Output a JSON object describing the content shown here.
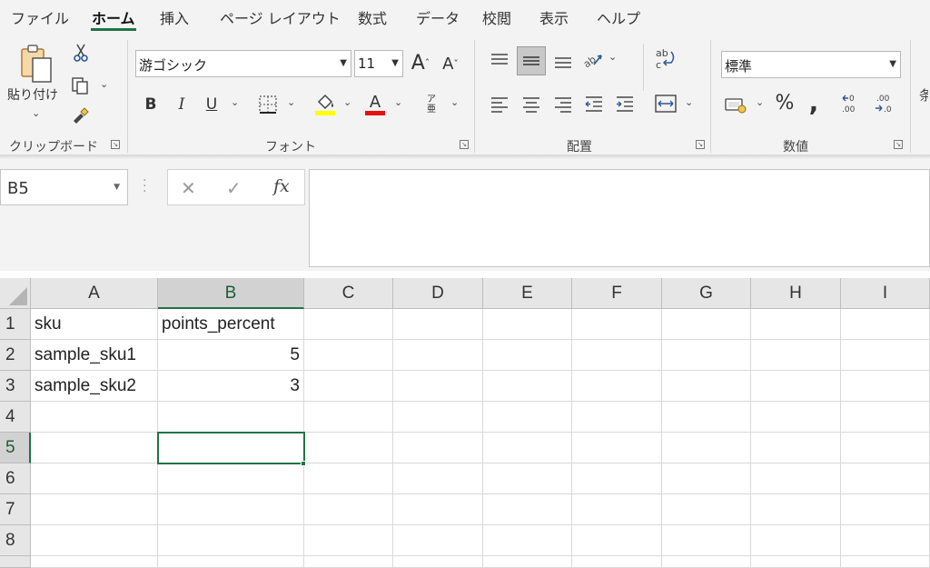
{
  "tabs": [
    "ファイル",
    "ホーム",
    "挿入",
    "ページ レイアウト",
    "数式",
    "データ",
    "校閲",
    "表示",
    "ヘルプ"
  ],
  "ribbon": {
    "clipboard": {
      "paste_label": "貼り付け",
      "group_label": "クリップボード"
    },
    "font": {
      "font_name": "游ゴシック",
      "font_size": "11",
      "group_label": "フォント"
    },
    "alignment": {
      "group_label": "配置"
    },
    "number": {
      "format": "標準",
      "group_label": "数値"
    }
  },
  "formula_bar": {
    "name_box": "B5",
    "content": ""
  },
  "grid": {
    "columns": [
      "A",
      "B",
      "C",
      "D",
      "E",
      "F",
      "G",
      "H",
      "I"
    ],
    "rows": [
      "1",
      "2",
      "3",
      "4",
      "5",
      "6",
      "7",
      "8"
    ],
    "cells": {
      "A1": "sku",
      "B1": "points_percent",
      "A2": "sample_sku1",
      "B2": "5",
      "A3": "sample_sku2",
      "B3": "3"
    },
    "active_cell": "B5",
    "accent": "#217346"
  },
  "icons": [
    "scissors-icon",
    "copy-icon",
    "format-painter-icon",
    "paste-icon",
    "borders-icon",
    "fill-color-icon",
    "font-color-icon",
    "furigana-icon",
    "wrap-text-icon",
    "merge-center-icon",
    "accounting-format-icon",
    "percent-icon",
    "comma-icon",
    "increase-decimal-icon",
    "decrease-decimal-icon"
  ]
}
